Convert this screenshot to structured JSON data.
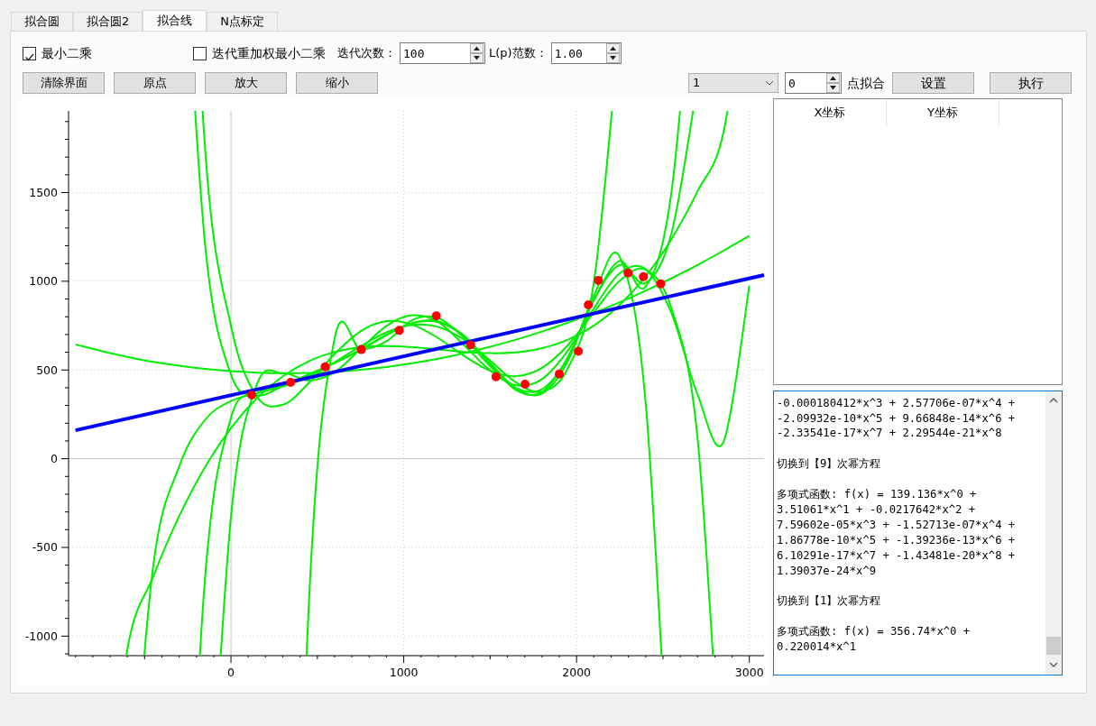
{
  "tabs": [
    {
      "label": "拟合圆",
      "selected": false
    },
    {
      "label": "拟合圆2",
      "selected": false
    },
    {
      "label": "拟合线",
      "selected": true
    },
    {
      "label": "N点标定",
      "selected": false
    }
  ],
  "options": [
    {
      "kind": "checkbox",
      "label": "最小二乘",
      "checked": true
    },
    {
      "kind": "checkbox",
      "label": "迭代重加权最小二乘",
      "checked": false
    },
    {
      "kind": "spin",
      "label": "迭代次数：",
      "value": "100"
    },
    {
      "kind": "spin",
      "label": "L(p)范数：",
      "value": "1.00"
    }
  ],
  "view_buttons": [
    "清除界面",
    "原点",
    "放大",
    "缩小"
  ],
  "fit_controls": {
    "combo_value": "1",
    "point_count": "0",
    "point_label": "点拟合",
    "buttons": [
      "设置",
      "执行"
    ]
  },
  "chart": {
    "chart_data": {
      "type": "scatter",
      "xlim": [
        -940,
        3085
      ],
      "ylim": [
        -1110,
        1960
      ],
      "xticks": [
        0,
        1000,
        2000,
        3000
      ],
      "yticks": [
        -1000,
        -500,
        0,
        500,
        1000,
        1500
      ],
      "grid": true,
      "series": [
        {
          "type": "scatter",
          "color": "#ff0000",
          "x": [
            120,
            345,
            545,
            754,
            974,
            1188,
            1387,
            1534,
            1702,
            1900,
            2010,
            2068,
            2126,
            2298,
            2387,
            2487
          ],
          "values": [
            359,
            430,
            518,
            615,
            723,
            805,
            641,
            462,
            420,
            477,
            605,
            867,
            1005,
            1046,
            1026,
            985
          ]
        },
        {
          "type": "line",
          "color": "#0000ff",
          "x": [
            -900,
            3085
          ],
          "values": [
            160,
            1035
          ]
        },
        {
          "type": "line",
          "color": "#00ee00",
          "values": [
            644,
            607,
            574,
            546,
            524,
            506,
            493,
            485,
            481,
            483,
            489,
            501,
            517,
            538,
            564,
            595,
            631,
            671,
            717,
            767,
            822,
            882,
            947,
            1017,
            1092,
            1172,
            1256
          ]
        },
        {
          "type": "line",
          "color": "#00ee00",
          "values": [
            null,
            null,
            -1077,
            -665,
            -324,
            -47,
            173,
            341,
            464,
            549,
            601,
            628,
            635,
            629,
            616,
            602,
            595,
            599,
            623,
            671,
            750,
            867,
            1028,
            1239,
            1507,
            1838,
            null
          ]
        },
        {
          "type": "line",
          "color": "#00ee00",
          "values": [
            null,
            null,
            null,
            null,
            null,
            1751,
            748,
            350,
            304,
            426,
            590,
            718,
            775,
            755,
            679,
            579,
            496,
            465,
            512,
            640,
            825,
            1003,
            1065,
            845,
            115,
            null,
            null
          ]
        },
        {
          "type": "line",
          "color": "#00ee00",
          "values": [
            null,
            null,
            null,
            -603,
            -44,
            219,
            325,
            369,
            407,
            464,
            544,
            634,
            712,
            754,
            742,
            670,
            553,
            430,
            378,
            510,
            993,
            null,
            null,
            null,
            null,
            null,
            null
          ]
        },
        {
          "type": "line",
          "color": "#00ee00",
          "values": [
            null,
            null,
            null,
            null,
            null,
            null,
            -324,
            419,
            482,
            441,
            488,
            618,
            749,
            808,
            770,
            639,
            497,
            414,
            449,
            610,
            847,
            1045,
            1068,
            818,
            362,
            94,
            975
          ]
        },
        {
          "type": "line",
          "color": "#00ee00",
          "values": [
            null,
            null,
            null,
            null,
            null,
            1211,
            474,
            358,
            410,
            476,
            539,
            614,
            699,
            764,
            769,
            689,
            540,
            396,
            367,
            551,
            918,
            1136,
            312,
            null,
            null,
            null,
            null
          ]
        },
        {
          "type": "line",
          "color": "#00ee00",
          "values": [
            null,
            null,
            null,
            null,
            null,
            -674,
            231,
            370,
            415,
            474,
            540,
            613,
            696,
            765,
            775,
            692,
            533,
            387,
            376,
            573,
            895,
            1092,
            991,
            1273,
            null,
            null,
            null
          ]
        },
        {
          "type": "line",
          "color": "#00ee00",
          "values": [
            null,
            null,
            null,
            null,
            null,
            null,
            null,
            null,
            null,
            -831,
            679,
            616,
            662,
            782,
            793,
            680,
            521,
            398,
            392,
            568,
            893,
            1114,
            970,
            1508,
            null,
            null,
            null
          ]
        }
      ],
      "x": [
        -900,
        -750,
        -600,
        -450,
        -300,
        -150,
        0,
        150,
        300,
        450,
        600,
        750,
        900,
        1050,
        1200,
        1350,
        1500,
        1650,
        1800,
        1950,
        2100,
        2250,
        2400,
        2550,
        2700,
        2850,
        3000
      ]
    }
  },
  "table": {
    "columns": [
      "X坐标",
      "Y坐标"
    ]
  },
  "log_entries": [
    {
      "lines": [
        "-0.000180412*x^3 + 2.57706e-07*x^4 +",
        "-2.09932e-10*x^5 + 9.66848e-14*x^6 +",
        "-2.33541e-17*x^7 + 2.29544e-21*x^8"
      ]
    },
    {
      "lines": [
        "切换到【9】次幂方程"
      ]
    },
    {
      "lines": [
        "多项式函数: f(x) = 139.136*x^0 +",
        "3.51061*x^1 + -0.0217642*x^2 +",
        "7.59602e-05*x^3 + -1.52713e-07*x^4 +",
        "1.86778e-10*x^5 + -1.39236e-13*x^6 +",
        "6.10291e-17*x^7 + -1.43481e-20*x^8 +",
        "1.39037e-24*x^9"
      ]
    },
    {
      "lines": [
        "切换到【1】次幂方程"
      ]
    },
    {
      "lines": [
        "多项式函数: f(x) = 356.74*x^0 +",
        "0.220014*x^1"
      ]
    }
  ]
}
